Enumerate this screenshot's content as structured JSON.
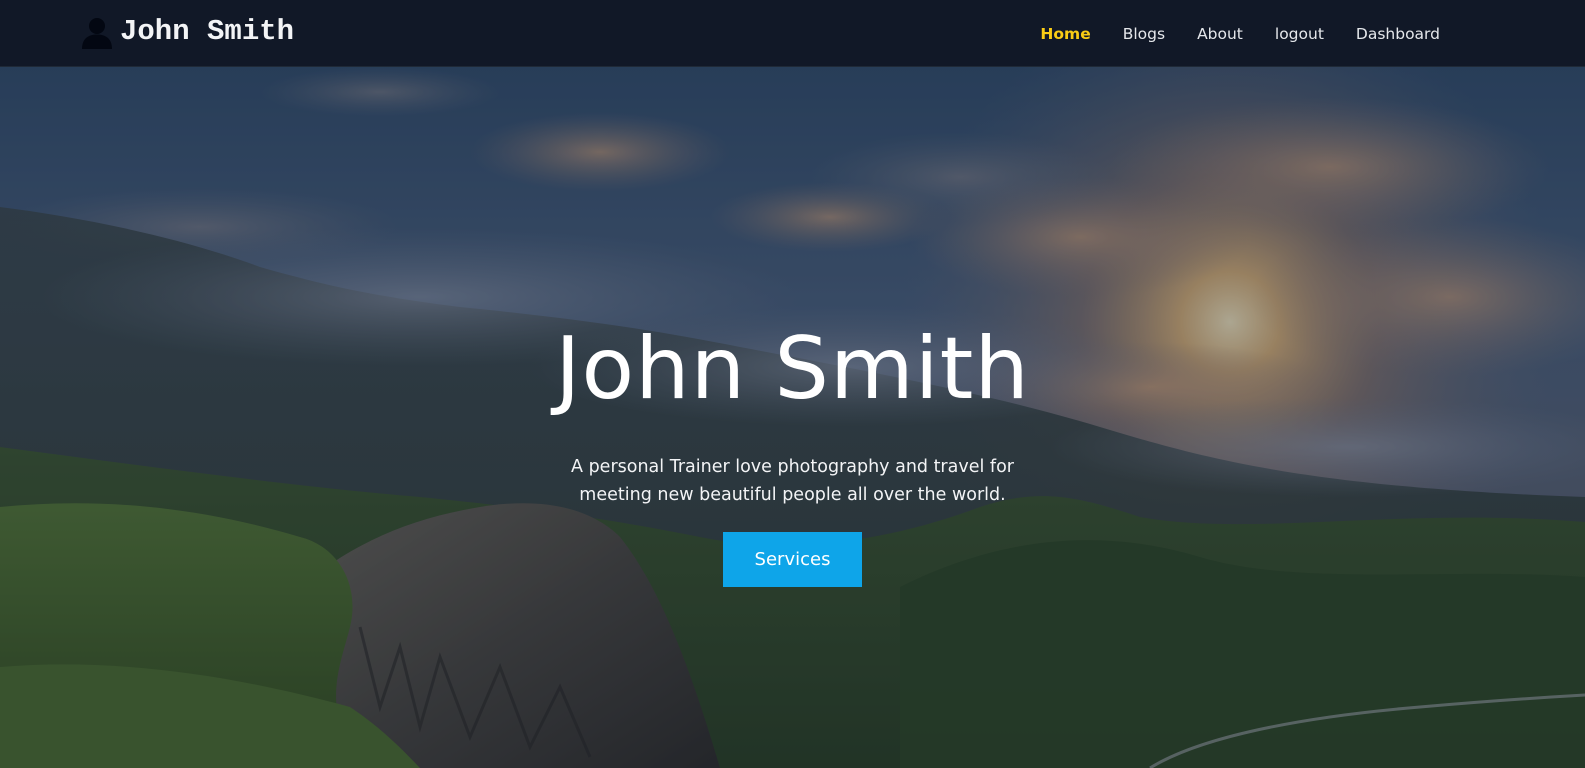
{
  "navbar": {
    "brand_icon": "user-silhouette-icon",
    "brand_name": "John Smith",
    "links": [
      {
        "label": "Home",
        "active": true
      },
      {
        "label": "Blogs",
        "active": false
      },
      {
        "label": "About",
        "active": false
      },
      {
        "label": "logout",
        "active": false
      },
      {
        "label": "Dashboard",
        "active": false
      }
    ],
    "active_color": "#facc15",
    "background_color": "#111827"
  },
  "hero": {
    "title": "John Smith",
    "subtitle": "A personal Trainer love photography and travel for meeting new beautiful people all over the world.",
    "button_label": "Services",
    "button_color": "#0ea5e9",
    "background_image": "mountain-landscape-sunset"
  }
}
